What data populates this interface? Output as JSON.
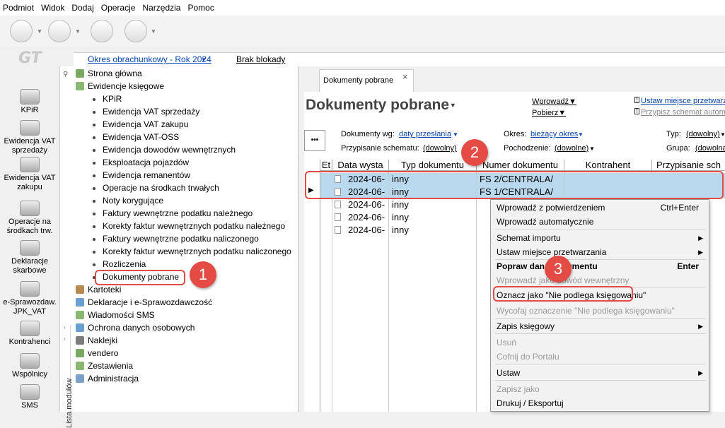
{
  "menubar": {
    "items": [
      "Podmiot",
      "Widok",
      "Dodaj",
      "Operacje",
      "Narzędzia",
      "Pomoc"
    ]
  },
  "logo": "GT",
  "leftnav": [
    {
      "label": "KPiR"
    },
    {
      "label": "Ewidencja VAT sprzedaży"
    },
    {
      "label": "Ewidencja VAT zakupu"
    },
    {
      "label": "Operacje na środkach trw."
    },
    {
      "label": "Deklaracje skarbowe"
    },
    {
      "label": "e-Sprawozdaw. JPK_VAT"
    },
    {
      "label": "Kontrahenci"
    },
    {
      "label": "Wspólnicy"
    },
    {
      "label": "SMS"
    }
  ],
  "periodbar": {
    "period": "Okres obrachunkowy - Rok 2024",
    "lock": "Brak blokady"
  },
  "tree": {
    "strona": "Strona główna",
    "ewidencje": "Ewidencje księgowe",
    "children": [
      "KPiR",
      "Ewidencja VAT sprzedaży",
      "Ewidencja VAT zakupu",
      "Ewidencja VAT-OSS",
      "Ewidencja dowodów wewnętrznych",
      "Eksploatacja pojazdów",
      "Ewidencja remanentów",
      "Operacje na środkach trwałych",
      "Noty korygujące",
      "Faktury wewnętrzne podatku należnego",
      "Korekty faktur wewnętrznych podatku należnego",
      "Faktury wewnętrzne podatku naliczonego",
      "Korekty faktur wewnętrznych podatku naliczonego",
      "Rozliczenia",
      "Dokumenty pobrane"
    ],
    "rest": [
      "Kartoteki",
      "Deklaracje i e-Sprawozdawczość",
      "Wiadomości SMS",
      "Ochrona danych osobowych",
      "Naklejki",
      "vendero",
      "Zestawienia",
      "Administracja"
    ]
  },
  "vlabel": "Lista modułów",
  "tab": {
    "label": "Dokumenty pobrane",
    "close": "×"
  },
  "panel": {
    "title": "Dokumenty pobrane",
    "more": "•••",
    "wprowadz": "Wprowadź",
    "pobierz": "Pobierz",
    "ustaw": "Ustaw miejsce przetwarz",
    "przypisz": "Przypisz schemat automa"
  },
  "filters": {
    "dok_label": "Dokumenty wg:",
    "dok_value": "daty przesłania",
    "przyp_label": "Przypisanie schematu:",
    "przyp_value": "(dowolny)",
    "okres_label": "Okres:",
    "okres_value": "bieżący okres",
    "poch_label": "Pochodzenie:",
    "poch_value": "(dowolne)",
    "typ_label": "Typ:",
    "typ_value": "(dowolny)",
    "grupa_label": "Grupa:",
    "grupa_value": "(dowolna"
  },
  "grid": {
    "headers": [
      "Et",
      "Data wysta",
      "Typ dokumentu",
      "Numer dokumentu",
      "Kontrahent",
      "Przypisanie sch"
    ],
    "rows": [
      {
        "date": "2024-06-",
        "type": "inny",
        "num": "FS 2/CENTRALA/"
      },
      {
        "date": "2024-06-",
        "type": "inny",
        "num": "FS 1/CENTRALA/"
      },
      {
        "date": "2024-06-",
        "type": "inny",
        "num": ""
      },
      {
        "date": "2024-06-",
        "type": "inny",
        "num": ""
      },
      {
        "date": "2024-06-",
        "type": "inny",
        "num": ""
      }
    ]
  },
  "ctx": {
    "i1": "Wprowadź z potwierdzeniem",
    "i1s": "Ctrl+Enter",
    "i2": "Wprowadź automatycznie",
    "i3": "Schemat importu",
    "i4": "Ustaw miejsce przetwarzania",
    "i5": "Popraw dane dokumentu",
    "i5s": "Enter",
    "i6": "Wprowadź jako dowód wewnętrzny",
    "i7": "Oznacz jako \"Nie podlega księgowaniu\"",
    "i8": "Wycofaj oznaczenie \"Nie podlega księgowaniu\"",
    "i9": "Zapis księgowy",
    "i10": "Usuń",
    "i11": "Cofnij do Portalu",
    "i12": "Ustaw",
    "i13": "Zapisz jako",
    "i14": "Drukuj / Eksportuj"
  },
  "badges": [
    "1",
    "2",
    "3"
  ],
  "colors": {
    "highlight": "#e34b44",
    "selection": "#b9d9ee",
    "link": "#0645ad"
  }
}
